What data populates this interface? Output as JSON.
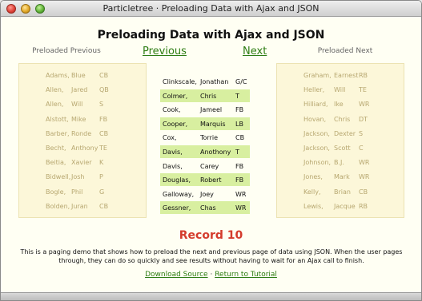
{
  "window": {
    "title": "Particletree · Preloading Data with Ajax and JSON"
  },
  "page": {
    "title": "Preloading Data with Ajax and JSON",
    "previous_heading": "Preloaded Previous",
    "next_heading": "Preloaded Next",
    "previous_link": "Previous",
    "next_link": "Next",
    "record_label": "Record 10",
    "description": "This is a paging demo that shows how to preload the next and previous page of data using JSON. When the user pages through, they can do so quickly and see results without having to wait for an Ajax call to finish.",
    "download_link": "Download Source",
    "separator": "·",
    "return_link": "Return to Tutorial"
  },
  "previous_rows": [
    {
      "last": "Adams,",
      "first": "Blue",
      "pos": "CB"
    },
    {
      "last": "Allen,",
      "first": "Jared",
      "pos": "QB"
    },
    {
      "last": "Allen,",
      "first": "Will",
      "pos": "S"
    },
    {
      "last": "Alstott,",
      "first": "Mike",
      "pos": "FB"
    },
    {
      "last": "Barber,",
      "first": "Ronde",
      "pos": "CB"
    },
    {
      "last": "Becht,",
      "first": "Anthony",
      "pos": "TE"
    },
    {
      "last": "Beitia,",
      "first": "Xavier",
      "pos": "K"
    },
    {
      "last": "Bidwell,",
      "first": "Josh",
      "pos": "P"
    },
    {
      "last": "Bogle,",
      "first": "Phil",
      "pos": "G"
    },
    {
      "last": "Bolden,",
      "first": "Juran",
      "pos": "CB"
    }
  ],
  "current_rows": [
    {
      "last": "Clinkscale,",
      "first": "Jonathan",
      "pos": "G/C"
    },
    {
      "last": "Colmer,",
      "first": "Chris",
      "pos": "T"
    },
    {
      "last": "Cook,",
      "first": "Jameel",
      "pos": "FB"
    },
    {
      "last": "Cooper,",
      "first": "Marquis",
      "pos": "LB"
    },
    {
      "last": "Cox,",
      "first": "Torrie",
      "pos": "CB"
    },
    {
      "last": "Davis,",
      "first": "Anothony",
      "pos": "T"
    },
    {
      "last": "Davis,",
      "first": "Carey",
      "pos": "FB"
    },
    {
      "last": "Douglas,",
      "first": "Robert",
      "pos": "FB"
    },
    {
      "last": "Galloway,",
      "first": "Joey",
      "pos": "WR"
    },
    {
      "last": "Gessner,",
      "first": "Chas",
      "pos": "WR"
    }
  ],
  "next_rows": [
    {
      "last": "Graham,",
      "first": "Earnest",
      "pos": "RB"
    },
    {
      "last": "Heller,",
      "first": "Will",
      "pos": "TE"
    },
    {
      "last": "Hilliard,",
      "first": "Ike",
      "pos": "WR"
    },
    {
      "last": "Hovan,",
      "first": "Chris",
      "pos": "DT"
    },
    {
      "last": "Jackson,",
      "first": "Dexter",
      "pos": "S"
    },
    {
      "last": "Jackson,",
      "first": "Scott",
      "pos": "C"
    },
    {
      "last": "Johnson,",
      "first": "B.J.",
      "pos": "WR"
    },
    {
      "last": "Jones,",
      "first": "Mark",
      "pos": "WR"
    },
    {
      "last": "Kelly,",
      "first": "Brian",
      "pos": "CB"
    },
    {
      "last": "Lewis,",
      "first": "Jacque",
      "pos": "RB"
    }
  ],
  "colors": {
    "accent_green": "#2e7d14",
    "record_red": "#d43b2d",
    "highlight_row": "#d8efa0",
    "panel_bg": "#fcf7d9",
    "muted_text": "#b7a770"
  }
}
